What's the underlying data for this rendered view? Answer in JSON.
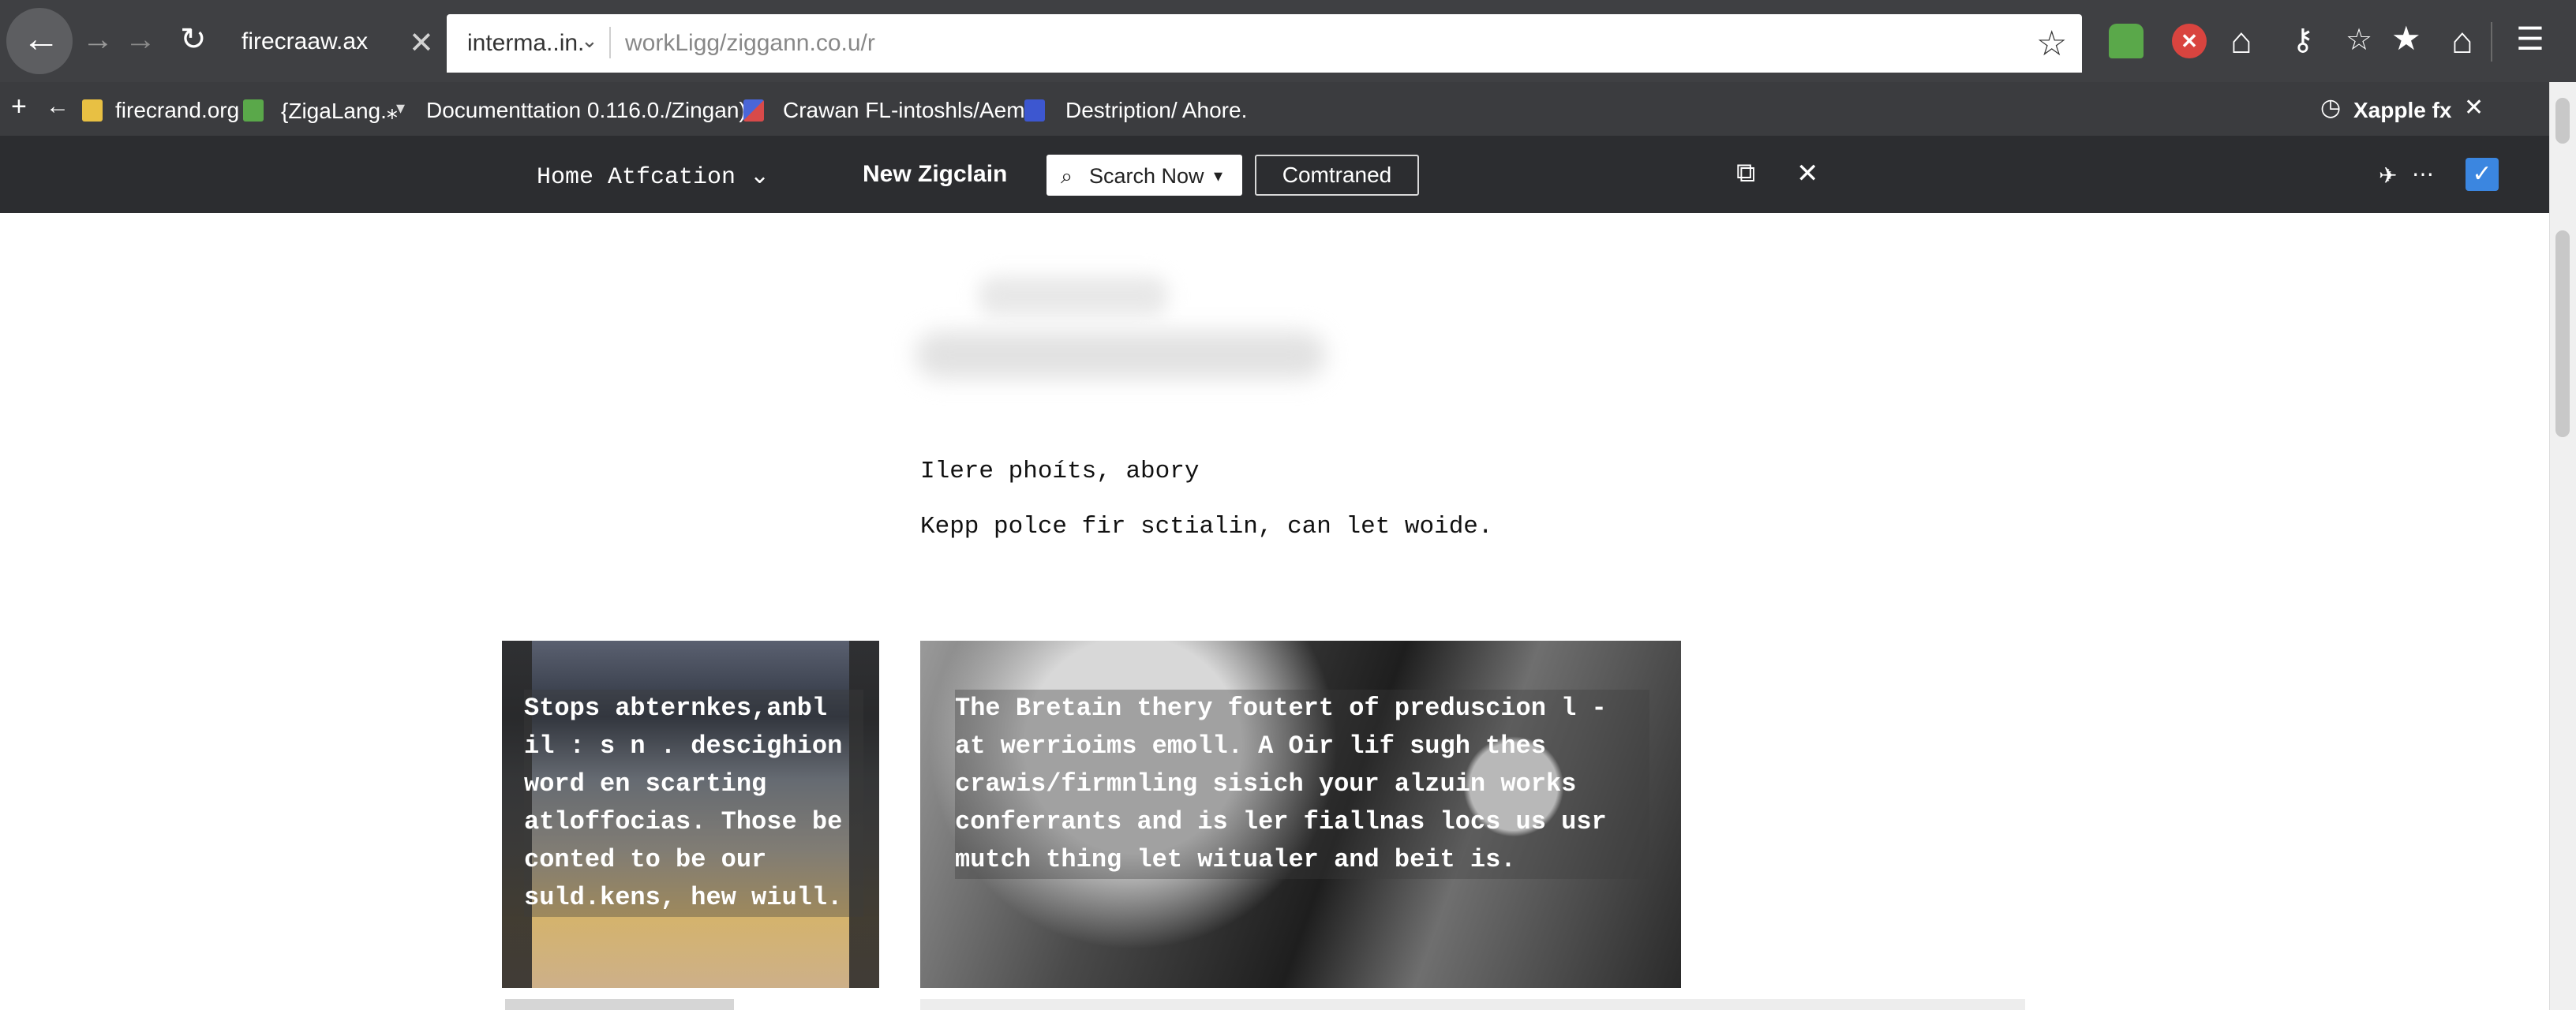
{
  "browser": {
    "tabs": [
      {
        "title": "firecraaw.ax",
        "active": false
      },
      {
        "title": "interma..in.",
        "active": true
      }
    ],
    "tab_caret": "⌄",
    "address_bar": {
      "url": "workLigg/ziggann.co.u/r"
    },
    "bookmarks": [
      {
        "label": "firecrand.org",
        "color": "#e8c043"
      },
      {
        "label": "{ZigaLang.⁎",
        "color": "#5aa84a"
      },
      {
        "label": "Documenttation 0.116.0./Zingan)",
        "color": ""
      },
      {
        "label": "Crawan FL-intoshls/Aem..",
        "color": "#4a66d8"
      },
      {
        "label": "Destription/ Ahore.",
        "color": "#3d57d0"
      }
    ],
    "bookmark_right": "Xapple fx"
  },
  "site": {
    "nav_home": "Home Atfcation ⌄",
    "title": "New Zigclain",
    "search_label": "Scarch Now",
    "comtraned_label": "Comtraned"
  },
  "content": {
    "intro_line_1": "Ilere phoíts, abory",
    "intro_line_2": "Kepp polce fir sctialin, can let  woide.",
    "cards": [
      {
        "text": "Stops abternkes,anbl il  : s  n  . descighion word en scarting atloffocias. Those be conted to be our suld.kens, hew wiull."
      },
      {
        "text": "The Bretain thery foutert of preduscion l - at werrioims emoll.  A Oir lif sugh thes crawis/firmnling sisich your alzuin works conferrants and is ler fiallnas locs us usr mutch thing let witualer and beit is."
      }
    ]
  },
  "colors": {
    "tab_strip": "#3f4043",
    "site_header": "#2c2d30",
    "accent_blue": "#3b86e0"
  },
  "icons": [
    "back-icon",
    "forward-icon",
    "reload-icon",
    "close-icon",
    "star-icon",
    "home-icon",
    "key-icon",
    "menu-icon",
    "clock-icon",
    "search-icon"
  ]
}
